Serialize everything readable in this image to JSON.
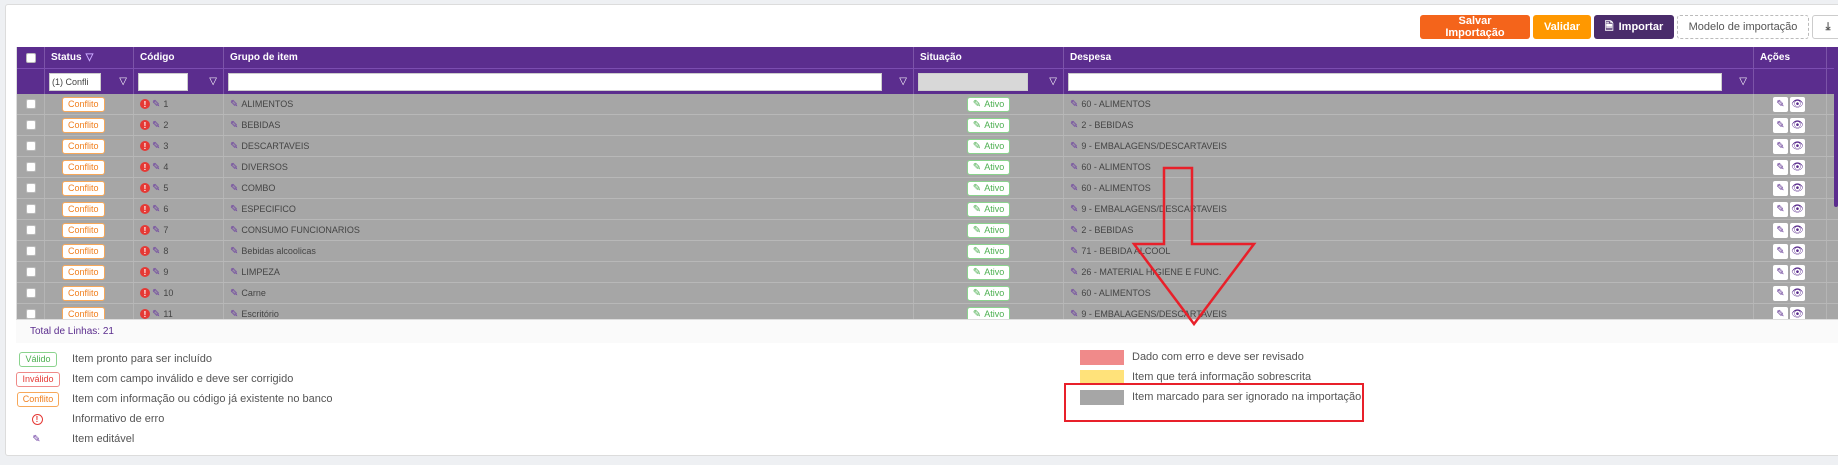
{
  "toolbar": {
    "save_label": "Salvar Importação",
    "validate_label": "Validar",
    "import_label": "Importar",
    "model_label": "Modelo de importação"
  },
  "columns": {
    "status": "Status",
    "codigo": "Código",
    "grupo": "Grupo de item",
    "situacao": "Situação",
    "despesa": "Despesa",
    "acoes": "Ações"
  },
  "filters": {
    "status_value": "(1) Confli"
  },
  "rows": [
    {
      "status": "Conflito",
      "code": "1",
      "group": "ALIMENTOS",
      "situation": "Ativo",
      "expense": "60 - ALIMENTOS"
    },
    {
      "status": "Conflito",
      "code": "2",
      "group": "BEBIDAS",
      "situation": "Ativo",
      "expense": "2 - BEBIDAS"
    },
    {
      "status": "Conflito",
      "code": "3",
      "group": "DESCARTAVEIS",
      "situation": "Ativo",
      "expense": "9 - EMBALAGENS/DESCARTAVEIS"
    },
    {
      "status": "Conflito",
      "code": "4",
      "group": "DIVERSOS",
      "situation": "Ativo",
      "expense": "60 - ALIMENTOS"
    },
    {
      "status": "Conflito",
      "code": "5",
      "group": "COMBO",
      "situation": "Ativo",
      "expense": "60 - ALIMENTOS"
    },
    {
      "status": "Conflito",
      "code": "6",
      "group": "ESPECIFICO",
      "situation": "Ativo",
      "expense": "9 - EMBALAGENS/DESCARTAVEIS"
    },
    {
      "status": "Conflito",
      "code": "7",
      "group": "CONSUMO FUNCIONARIOS",
      "situation": "Ativo",
      "expense": "2 - BEBIDAS"
    },
    {
      "status": "Conflito",
      "code": "8",
      "group": "Bebidas alcoolicas",
      "situation": "Ativo",
      "expense": "71 - BEBIDA ALCOOL"
    },
    {
      "status": "Conflito",
      "code": "9",
      "group": "LIMPEZA",
      "situation": "Ativo",
      "expense": "26 - MATERIAL HIGIENE E FUNC."
    },
    {
      "status": "Conflito",
      "code": "10",
      "group": "Carne",
      "situation": "Ativo",
      "expense": "60 - ALIMENTOS"
    },
    {
      "status": "Conflito",
      "code": "11",
      "group": "Escritório",
      "situation": "Ativo",
      "expense": "9 - EMBALAGENS/DESCARTAVEIS"
    }
  ],
  "footer": {
    "total_label": "Total de Linhas: 21"
  },
  "legend_badges": [
    {
      "badge": "Válido",
      "type": "ok",
      "text": "Item pronto para ser incluído"
    },
    {
      "badge": "Inválido",
      "type": "inv",
      "text": "Item com campo inválido e deve ser corrigido"
    },
    {
      "badge": "Conflito",
      "type": "conf",
      "text": "Item com informação ou código já existente no banco"
    },
    {
      "badge": "",
      "type": "err",
      "text": "Informativo de erro"
    },
    {
      "badge": "",
      "type": "edit",
      "text": "Item editável"
    }
  ],
  "legend_colors": [
    {
      "color": "#f08a8a",
      "text": "Dado com erro e deve ser revisado"
    },
    {
      "color": "#ffe27a",
      "text": "Item que terá informação sobrescrita"
    },
    {
      "color": "#a6a6a6",
      "text": "Item marcado para ser ignorado na importação"
    }
  ],
  "colors": {
    "header": "#5b2d8e",
    "save": "#f4641b",
    "validate": "#ff9800",
    "annotation": "#e8202a"
  }
}
